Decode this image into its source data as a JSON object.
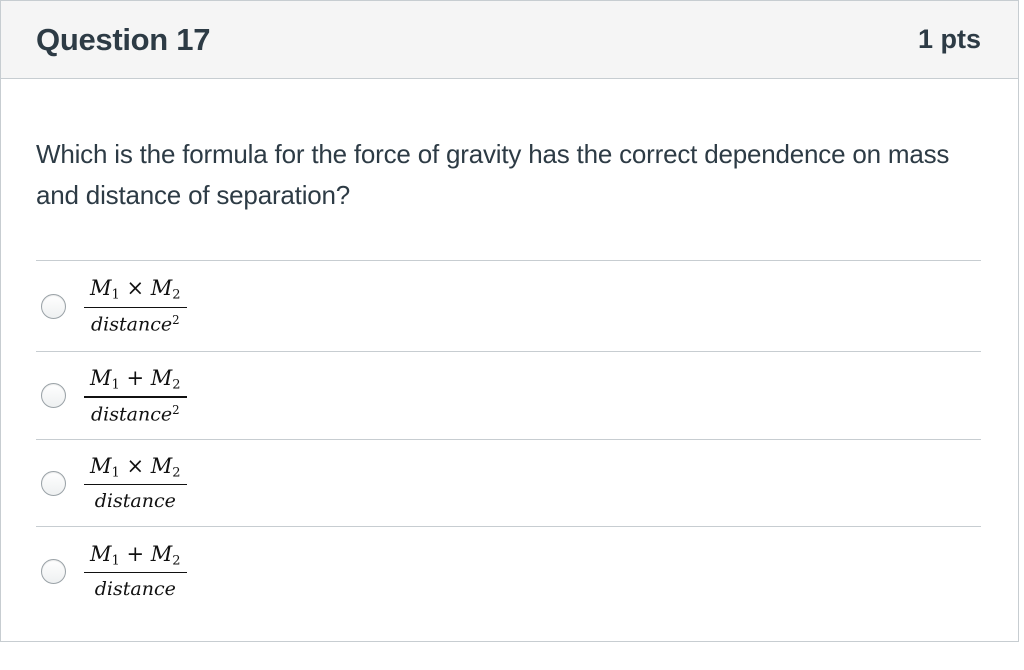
{
  "question": {
    "title": "Question 17",
    "points": "1 pts",
    "text": "Which is the formula for the force of gravity has the correct dependence on mass and distance of separation?"
  },
  "answers": [
    {
      "var1": "M",
      "sub1": "1",
      "operator": "×",
      "var2": "M",
      "sub2": "2",
      "denominator": "distance",
      "exponent": "2"
    },
    {
      "var1": "M",
      "sub1": "1",
      "operator": "+",
      "var2": "M",
      "sub2": "2",
      "denominator": "distance",
      "exponent": "2"
    },
    {
      "var1": "M",
      "sub1": "1",
      "operator": "×",
      "var2": "M",
      "sub2": "2",
      "denominator": "distance",
      "exponent": ""
    },
    {
      "var1": "M",
      "sub1": "1",
      "operator": "+",
      "var2": "M",
      "sub2": "2",
      "denominator": "distance",
      "exponent": ""
    }
  ],
  "icons": {
    "radio": "radio-button-icon"
  }
}
